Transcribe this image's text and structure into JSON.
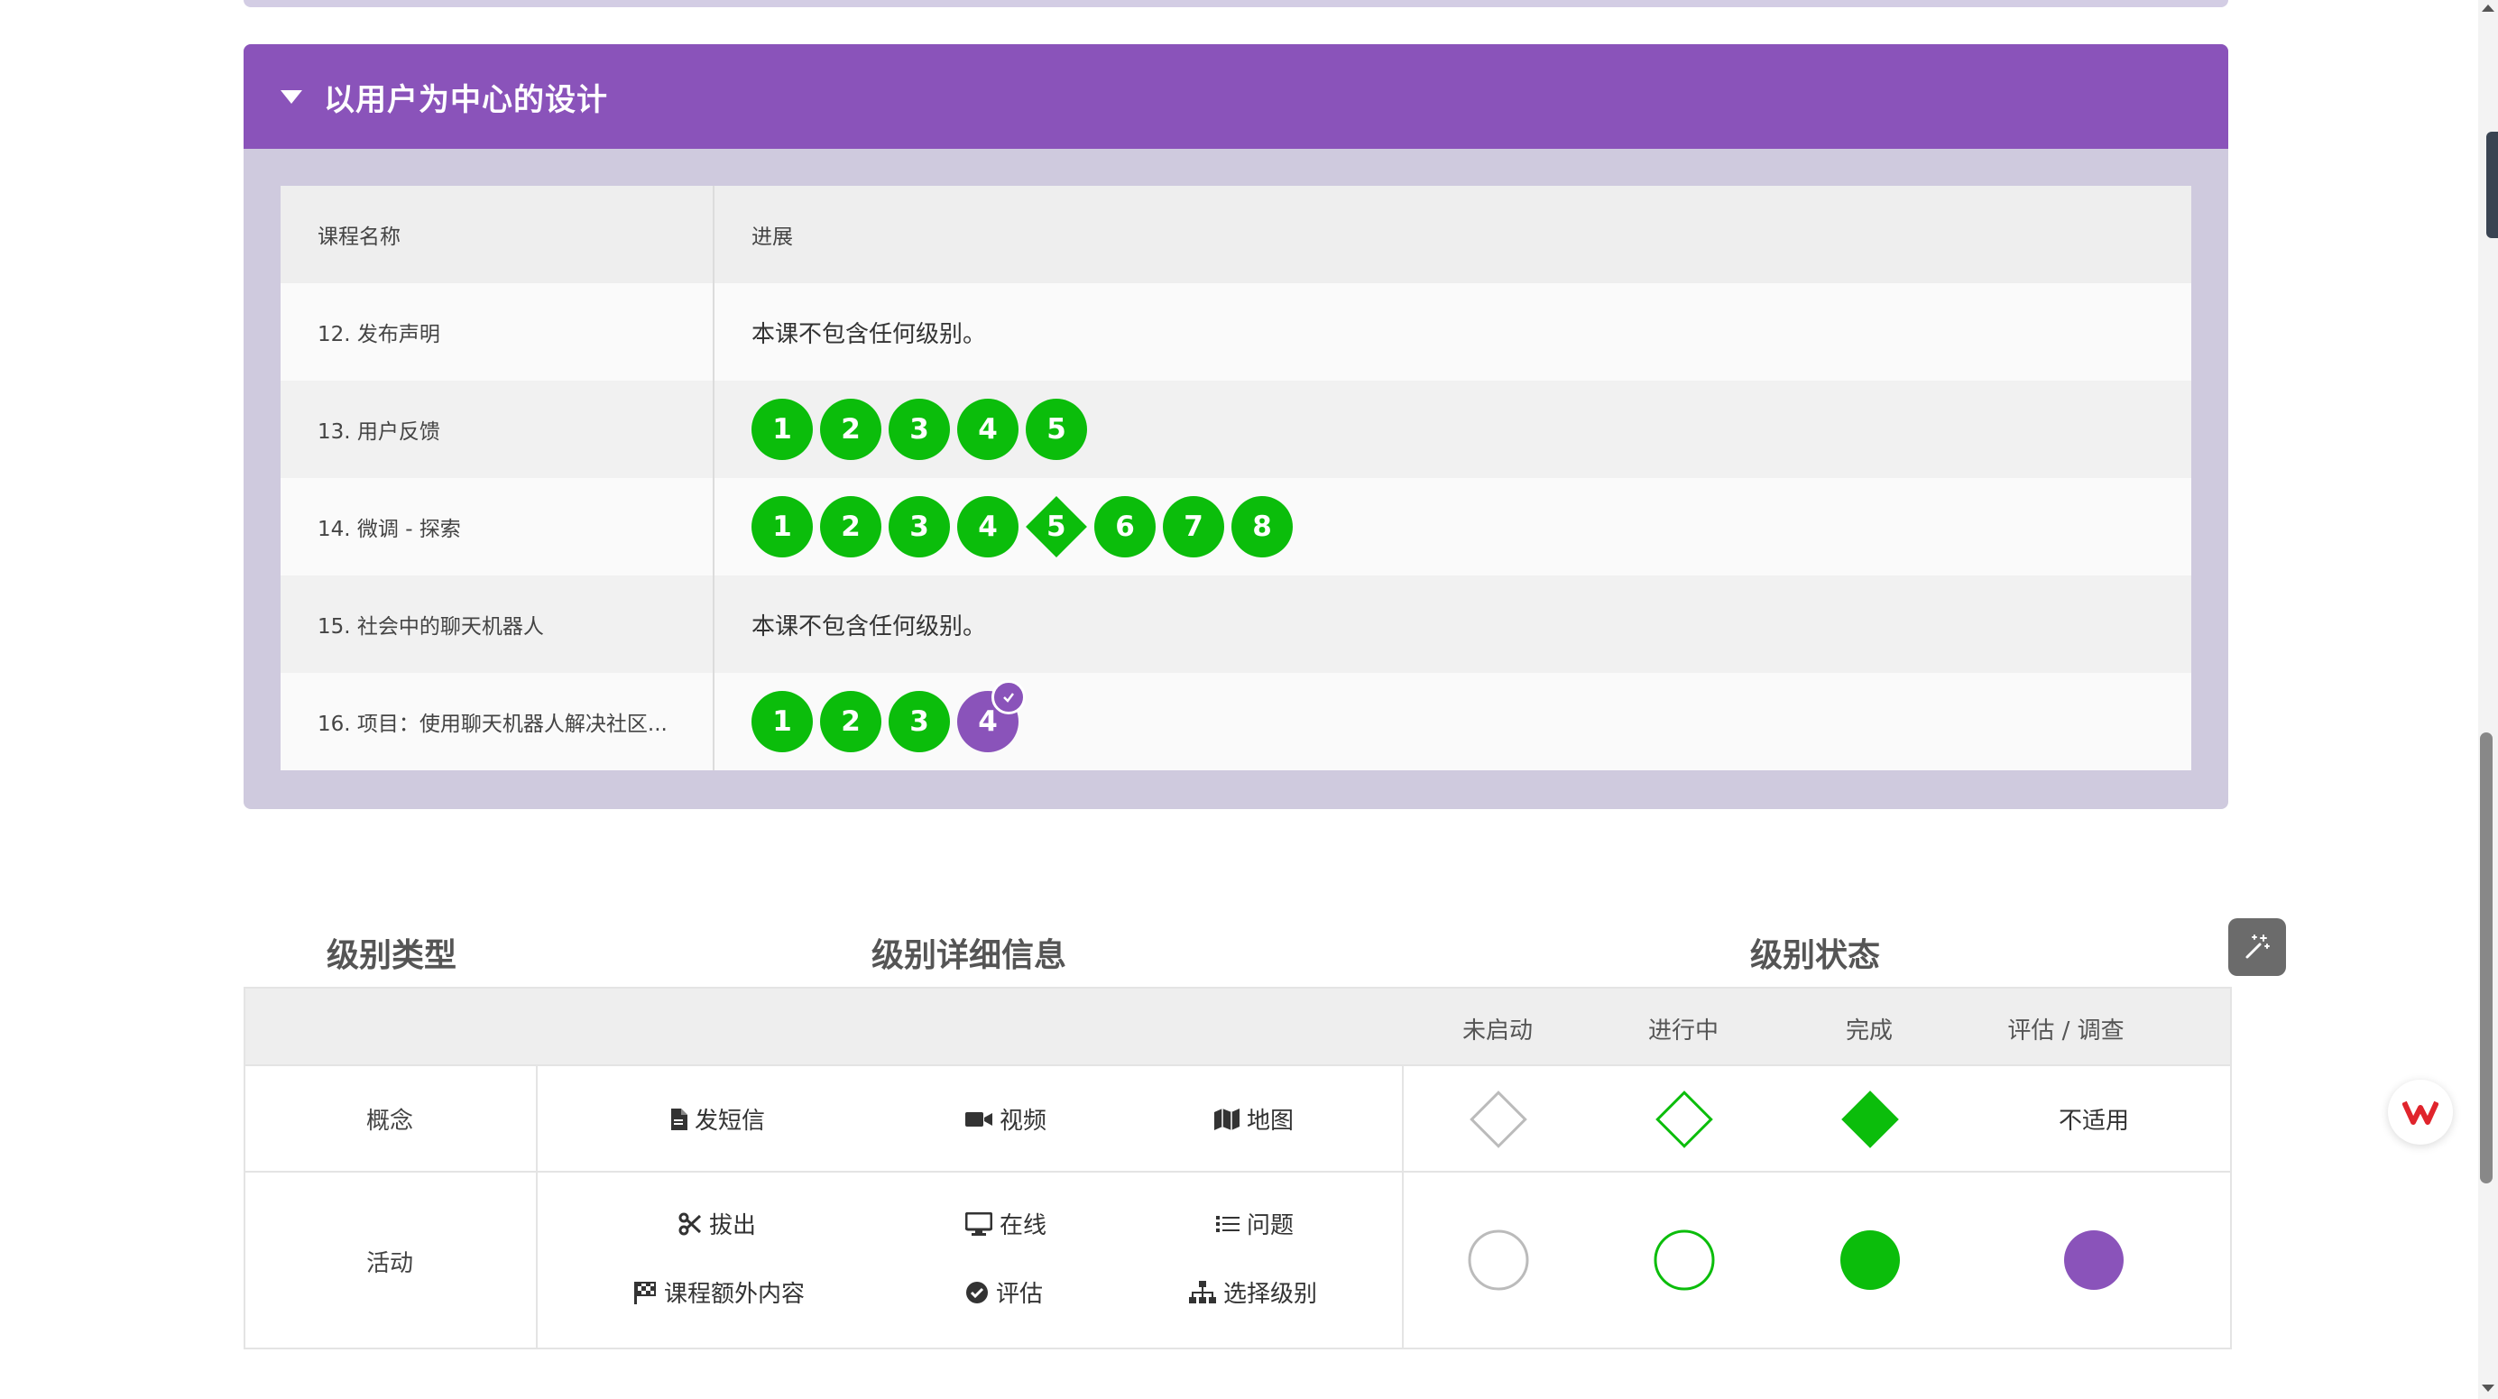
{
  "section": {
    "title": "以用户为中心的设计"
  },
  "lessons_table": {
    "headers": [
      "课程名称",
      "进展"
    ],
    "rows": [
      {
        "name": "12. 发布声明",
        "note": "本课不包含任何级别。"
      },
      {
        "name": "13. 用户反馈",
        "levels": [
          "1",
          "2",
          "3",
          "4",
          "5"
        ]
      },
      {
        "name": "14. 微调 - 探索",
        "levels": [
          "1",
          "2",
          "3",
          "4",
          "5",
          "6",
          "7",
          "8"
        ]
      },
      {
        "name": "15. 社会中的聊天机器人",
        "note": "本课不包含任何级别。"
      },
      {
        "name": "16. 项目：使用聊天机器人解决社区...",
        "levels": [
          "1",
          "2",
          "3",
          "4"
        ]
      }
    ]
  },
  "legend": {
    "type_title": "级别类型",
    "detail_title": "级别详细信息",
    "status_title": "级别状态",
    "status_headers": [
      "未启动",
      "进行中",
      "完成",
      "评估 / 调查"
    ],
    "concept": {
      "label": "概念",
      "items": [
        "发短信",
        "视频",
        "地图"
      ],
      "na": "不适用"
    },
    "activity": {
      "label": "活动",
      "items": [
        "拔出",
        "在线",
        "问题",
        "课程额外内容",
        "评估",
        "选择级别"
      ]
    }
  },
  "colors": {
    "accent_purple": "#8a53ba",
    "complete_green": "#0bbd0b"
  }
}
